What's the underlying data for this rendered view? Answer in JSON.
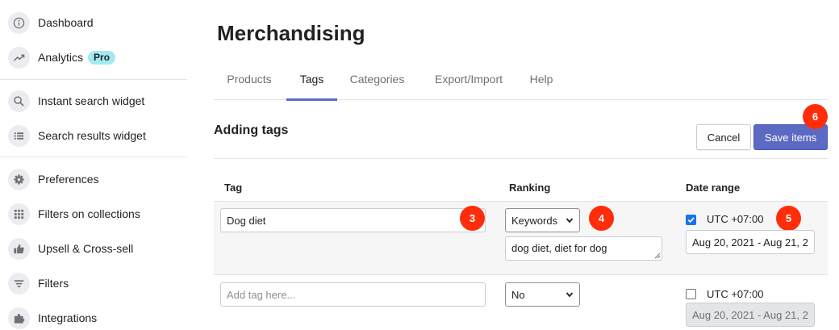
{
  "sidebar": {
    "items": [
      {
        "label": "Dashboard",
        "icon": "info-icon"
      },
      {
        "label": "Analytics",
        "icon": "trend-icon",
        "badge": "Pro"
      },
      {
        "label": "Instant search widget",
        "icon": "search-icon"
      },
      {
        "label": "Search results widget",
        "icon": "list-icon"
      },
      {
        "label": "Preferences",
        "icon": "gear-icon"
      },
      {
        "label": "Filters on collections",
        "icon": "grid-icon"
      },
      {
        "label": "Upsell & Cross-sell",
        "icon": "thumbs-up-icon"
      },
      {
        "label": "Filters",
        "icon": "filter-icon"
      },
      {
        "label": "Integrations",
        "icon": "puzzle-icon"
      }
    ]
  },
  "page": {
    "title": "Merchandising",
    "tabs": [
      "Products",
      "Tags",
      "Categories",
      "Export/Import",
      "Help"
    ],
    "active_tab": "Tags"
  },
  "section": {
    "title": "Adding tags",
    "cancel_label": "Cancel",
    "save_label": "Save items"
  },
  "table": {
    "headers": {
      "tag": "Tag",
      "ranking": "Ranking",
      "date_range": "Date range"
    },
    "rows": [
      {
        "tag_value": "Dog diet",
        "ranking": "Keywords",
        "keywords": "dog diet, diet for dog",
        "use_date": true,
        "timezone": "UTC +07:00",
        "date_range": "Aug 20, 2021 - Aug 21, 2"
      },
      {
        "tag_placeholder": "Add tag here...",
        "ranking": "No",
        "use_date": false,
        "timezone": "UTC +07:00",
        "date_range": "Aug 20, 2021 - Aug 21, 2"
      }
    ]
  },
  "steps": {
    "tag": "3",
    "ranking": "4",
    "date": "5",
    "save": "6"
  },
  "colors": {
    "accent": "#5c6ac4",
    "step_badge": "#ff2d0a",
    "pro_badge": "#a4e8f2",
    "checkbox": "#1a73e8"
  }
}
